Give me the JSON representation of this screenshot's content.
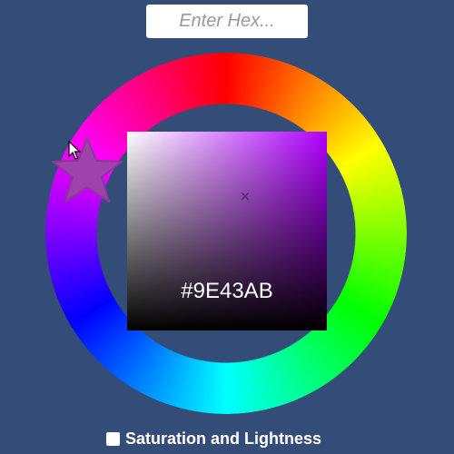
{
  "hex_input": {
    "placeholder": "Enter Hex...",
    "value": ""
  },
  "picker": {
    "selected_hex": "#9E43AB",
    "hue_color": "#b000ff",
    "handle_color": "#9E43AB",
    "sv_marker_glyph": "×"
  },
  "options": {
    "saturation_lightness_label": "Saturation and Lightness",
    "saturation_lightness_checked": false
  },
  "icons": {
    "hue_handle": "star-icon",
    "pointer": "mouse-cursor-icon",
    "sv_marker": "cross-marker-icon"
  }
}
